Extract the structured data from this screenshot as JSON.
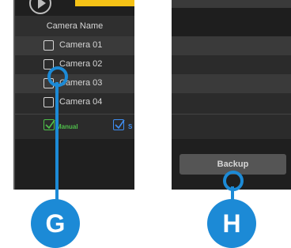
{
  "left_panel": {
    "column_header": "Camera Name",
    "cameras": [
      {
        "label": "Camera 01"
      },
      {
        "label": "Camera 02"
      },
      {
        "label": "Camera 03"
      },
      {
        "label": "Camera 04"
      }
    ],
    "modes": {
      "manual_label": "Manual",
      "second_label": "S"
    }
  },
  "right_panel": {
    "backup_label": "Backup"
  },
  "callouts": {
    "g": "G",
    "h": "H"
  },
  "colors": {
    "callout": "#1c8ad6",
    "manual": "#4fbf4b",
    "secondary": "#3f8df0",
    "accent_tab": "#f6c216"
  }
}
